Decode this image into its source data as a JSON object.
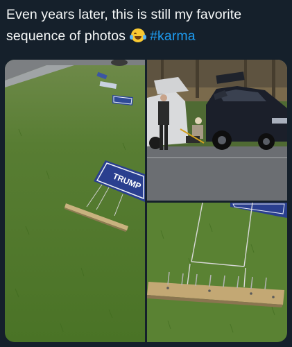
{
  "tweet": {
    "text_line1": "Even years later, this is still my favorite",
    "text_line2": "sequence of photos",
    "emoji": "face-with-tears-of-joy",
    "hashtag": "#karma"
  },
  "media": {
    "sign_text": "TRUMP",
    "colors": {
      "grass": "#4f7a2c",
      "sign_blue": "#2a3f8f",
      "car": "#1b1f2a",
      "road": "#6b6e72",
      "hashtag": "#1d9bf0"
    }
  }
}
